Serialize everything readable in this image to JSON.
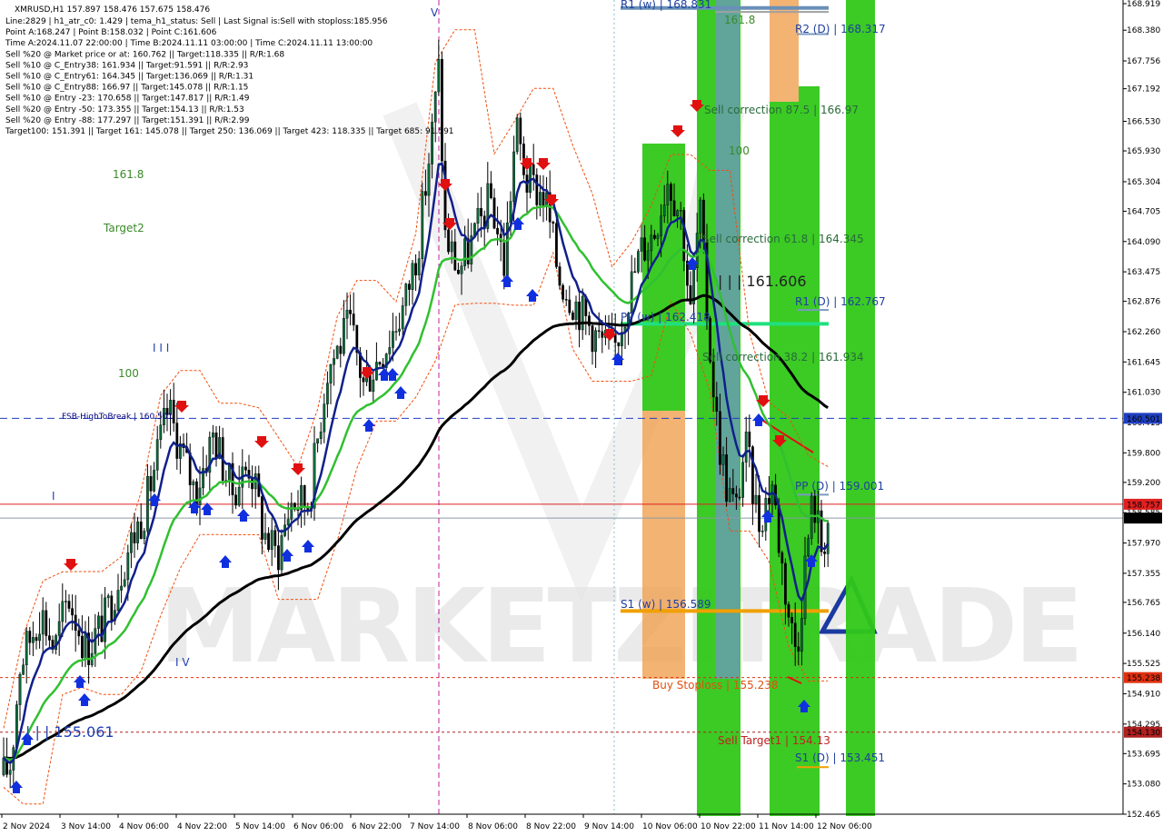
{
  "chart_data": {
    "type": "candlestick",
    "symbol_line": "XMRUSD,H1  157.897 158.476 157.675 158.476",
    "info_lines": [
      "Line:2829  |  h1_atr_c0: 1.429  |  tema_h1_status: Sell  |  Last Signal is:Sell with stoploss:185.956",
      "Point A:168.247  |  Point B:158.032  |  Point C:161.606",
      "Time A:2024.11.07 22:00:00  |  Time B:2024.11.11 03:00:00  |  Time C:2024.11.11 13:00:00",
      "Sell %20 @ Market price or at: 160.762  ||  Target:118.335  ||  R/R:1.68",
      "Sell %10 @ C_Entry38: 161.934  ||  Target:91.591  ||  R/R:2.93",
      "Sell %10 @ C_Entry61: 164.345  ||  Target:136.069  ||  R/R:1.31",
      "Sell %10 @ C_Entry88: 166.97  ||  Target:145.078  ||  R/R:1.15",
      "Sell %10 @ Entry -23: 170.658  ||  Target:147.817  ||  R/R:1.49",
      "Sell %20 @ Entry -50: 173.355  ||  Target:154.13  ||  R/R:1.53",
      "Sell %20 @ Entry -88: 177.297  ||  Target:151.391  ||  R/R:2.99",
      "Target100: 151.391  ||  Target 161: 145.078  ||  Target 250: 136.069  ||  Target 423: 118.335  ||  Target 685: 91.591"
    ],
    "y_ticks": [
      "168.919",
      "168.380",
      "167.756",
      "167.192",
      "166.530",
      "165.930",
      "165.304",
      "164.705",
      "164.090",
      "163.475",
      "162.876",
      "162.260",
      "161.645",
      "161.030",
      "160.415",
      "159.800",
      "159.200",
      "158.585",
      "157.970",
      "157.355",
      "156.765",
      "156.140",
      "155.525",
      "154.910",
      "154.295",
      "153.695",
      "153.080",
      "152.465"
    ],
    "x_ticks": [
      "2 Nov 2024",
      "3 Nov 14:00",
      "4 Nov 06:00",
      "4 Nov 22:00",
      "5 Nov 14:00",
      "6 Nov 06:00",
      "6 Nov 22:00",
      "7 Nov 14:00",
      "8 Nov 06:00",
      "8 Nov 22:00",
      "9 Nov 14:00",
      "10 Nov 06:00",
      "10 Nov 22:00",
      "11 Nov 14:00",
      "12 Nov 06:00"
    ],
    "ylim": [
      152.465,
      168.919
    ],
    "price_tags": [
      {
        "text": "160.501",
        "value": 160.501,
        "color": "#1f3fc0"
      },
      {
        "text": "158.757",
        "value": 158.757,
        "color": "#e02020"
      },
      {
        "text": "158.476",
        "value": 158.476,
        "color": "#000000"
      },
      {
        "text": "155.238",
        "value": 155.238,
        "color": "#e03010"
      },
      {
        "text": "154.130",
        "value": 154.13,
        "color": "#b02020"
      }
    ],
    "level_labels": [
      {
        "text": "R1 (w) | 168.831",
        "value": 168.831,
        "color": "#2040a0"
      },
      {
        "text": "R2 (D) | 168.317",
        "value": 168.317,
        "color": "#2040a0"
      },
      {
        "text": "Sell correction 87.5 | 166.97",
        "value": 166.97,
        "color": "#2a6a3a"
      },
      {
        "text": "Sell correction 61.8 | 164.345",
        "value": 164.345,
        "color": "#2a6a3a"
      },
      {
        "text": "| | | 161.606",
        "value": 163.28,
        "color": "#222222"
      },
      {
        "text": "R1 (D) | 162.767",
        "value": 162.767,
        "color": "#2040a0"
      },
      {
        "text": "PP (w) | 162.418",
        "value": 162.418,
        "color": "#2040a0"
      },
      {
        "text": "Sell correction 38.2 | 161.934",
        "value": 161.934,
        "color": "#2a6a3a"
      },
      {
        "text": "FSB-HighToBreak | 160.501",
        "value": 160.501,
        "color": "#000080"
      },
      {
        "text": "PP (D) | 159.001",
        "value": 159.001,
        "color": "#2040a0"
      },
      {
        "text": "S1 (w) | 156.589",
        "value": 156.589,
        "color": "#2040a0"
      },
      {
        "text": "Buy Stoploss | 155.238",
        "value": 155.238,
        "color": "#e05010"
      },
      {
        "text": "Sell Target1 | 154.13",
        "value": 154.13,
        "color": "#c02020"
      },
      {
        "text": "S1 (D) | 153.451",
        "value": 153.451,
        "color": "#2040a0"
      },
      {
        "text": "| | | 155.061",
        "value": 155.061,
        "color": "#2040b0"
      },
      {
        "text": "161.8",
        "value": 166.9,
        "color": "#3a8a2a"
      },
      {
        "text": "Target2",
        "value": 165.92,
        "color": "#3a8a2a"
      },
      {
        "text": "100",
        "value": 161.45,
        "color": "#3a8a2a"
      },
      {
        "text": "100",
        "value": 166.35,
        "color": "#3a8a2a"
      },
      {
        "text": "161.8",
        "value": 168.48,
        "color": "#3a8a2a"
      },
      {
        "text": "I I I",
        "value": 162.05,
        "color": "#2040b0"
      },
      {
        "text": "I V",
        "value": 155.72,
        "color": "#2040b0"
      },
      {
        "text": "I",
        "value": 159.2,
        "color": "#2040b0"
      },
      {
        "text": "V",
        "value": 168.8,
        "color": "#2040b0"
      }
    ],
    "watermark": "MARKETZITRADE",
    "colors": {
      "up": "#0a6a3a",
      "down": "#000000",
      "tema": "#10208a",
      "ma_green": "#30c030",
      "ma_black": "#000000",
      "zone_green": "#30c818",
      "zone_orange": "#f0a050",
      "zone_blue": "#6a9ab8",
      "fsb_line": "#1f3fc0"
    }
  }
}
